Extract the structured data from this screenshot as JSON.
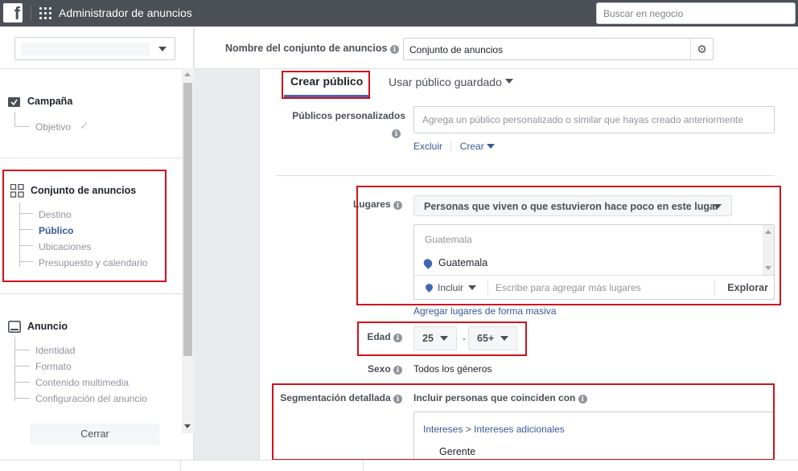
{
  "topbar": {
    "app_title": "Administrador de anuncios",
    "search_placeholder": "Buscar en negocio"
  },
  "sidebar": {
    "sections": [
      {
        "title": "Campaña",
        "items": [
          "Objetivo"
        ]
      },
      {
        "title": "Conjunto de anuncios",
        "items": [
          "Destino",
          "Público",
          "Ubicaciones",
          "Presupuesto y calendario"
        ],
        "active": "Público"
      },
      {
        "title": "Anuncio",
        "items": [
          "Identidad",
          "Formato",
          "Contenido multimedia",
          "Configuración del anuncio"
        ]
      }
    ],
    "close_label": "Cerrar"
  },
  "header": {
    "name_label": "Nombre del conjunto de anuncios",
    "name_value": "Conjunto de anuncios"
  },
  "audience": {
    "tab_create": "Crear público",
    "tab_saved": "Usar público guardado",
    "custom_label": "Públicos personalizados",
    "custom_placeholder": "Agrega un público personalizado o similar que hayas creado anteriormente",
    "exclude_link": "Excluir",
    "create_link": "Crear",
    "locations_label": "Lugares",
    "locations_mode": "Personas que viven o que estuvieron hace poco en este lugar",
    "location_country": "Guatemala",
    "location_selected": "Guatemala",
    "include_label": "Incluir",
    "locations_placeholder": "Escribe para agregar más lugares",
    "explore_label": "Explorar",
    "bulk_locations_link": "Agregar lugares de forma masiva",
    "age_label": "Edad",
    "age_min": "25",
    "age_dash": "-",
    "age_max": "65+",
    "gender_label": "Sexo",
    "gender_value": "Todos los géneros",
    "detailed_label": "Segmentación detallada",
    "detailed_heading": "Incluir personas que coinciden con",
    "crumb_interests": "Intereses",
    "crumb_sep": ">",
    "crumb_additional": "Intereses adicionales",
    "interest_item": "Gerente"
  },
  "colors": {
    "topbar": "#4b4f56",
    "link": "#365899",
    "tab_underline": "#4267b2",
    "highlight_box": "#d0121b"
  }
}
